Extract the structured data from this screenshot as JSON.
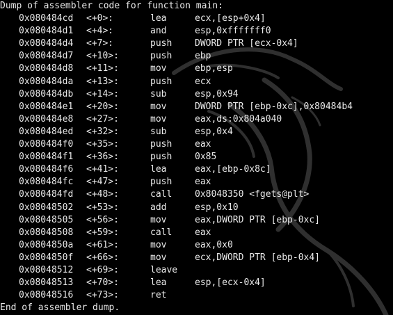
{
  "terminal": {
    "background": "#000000",
    "text_color": "#e9e9e9",
    "watermark": "kali-dragon-logo",
    "header": "Dump of assembler code for function main:",
    "footer": "End of assembler dump.",
    "rows": [
      {
        "addr": "0x080484cd",
        "off": "<+0>:",
        "mnem": "lea",
        "ops": "ecx,[esp+0x4]"
      },
      {
        "addr": "0x080484d1",
        "off": "<+4>:",
        "mnem": "and",
        "ops": "esp,0xfffffff0"
      },
      {
        "addr": "0x080484d4",
        "off": "<+7>:",
        "mnem": "push",
        "ops": "DWORD PTR [ecx-0x4]"
      },
      {
        "addr": "0x080484d7",
        "off": "<+10>:",
        "mnem": "push",
        "ops": "ebp"
      },
      {
        "addr": "0x080484d8",
        "off": "<+11>:",
        "mnem": "mov",
        "ops": "ebp,esp"
      },
      {
        "addr": "0x080484da",
        "off": "<+13>:",
        "mnem": "push",
        "ops": "ecx"
      },
      {
        "addr": "0x080484db",
        "off": "<+14>:",
        "mnem": "sub",
        "ops": "esp,0x94"
      },
      {
        "addr": "0x080484e1",
        "off": "<+20>:",
        "mnem": "mov",
        "ops": "DWORD PTR [ebp-0xc],0x80484b4"
      },
      {
        "addr": "0x080484e8",
        "off": "<+27>:",
        "mnem": "mov",
        "ops": "eax,ds:0x804a040"
      },
      {
        "addr": "0x080484ed",
        "off": "<+32>:",
        "mnem": "sub",
        "ops": "esp,0x4"
      },
      {
        "addr": "0x080484f0",
        "off": "<+35>:",
        "mnem": "push",
        "ops": "eax"
      },
      {
        "addr": "0x080484f1",
        "off": "<+36>:",
        "mnem": "push",
        "ops": "0x85"
      },
      {
        "addr": "0x080484f6",
        "off": "<+41>:",
        "mnem": "lea",
        "ops": "eax,[ebp-0x8c]"
      },
      {
        "addr": "0x080484fc",
        "off": "<+47>:",
        "mnem": "push",
        "ops": "eax"
      },
      {
        "addr": "0x080484fd",
        "off": "<+48>:",
        "mnem": "call",
        "ops": "0x8048350 <fgets@plt>"
      },
      {
        "addr": "0x08048502",
        "off": "<+53>:",
        "mnem": "add",
        "ops": "esp,0x10"
      },
      {
        "addr": "0x08048505",
        "off": "<+56>:",
        "mnem": "mov",
        "ops": "eax,DWORD PTR [ebp-0xc]"
      },
      {
        "addr": "0x08048508",
        "off": "<+59>:",
        "mnem": "call",
        "ops": "eax"
      },
      {
        "addr": "0x0804850a",
        "off": "<+61>:",
        "mnem": "mov",
        "ops": "eax,0x0"
      },
      {
        "addr": "0x0804850f",
        "off": "<+66>:",
        "mnem": "mov",
        "ops": "ecx,DWORD PTR [ebp-0x4]"
      },
      {
        "addr": "0x08048512",
        "off": "<+69>:",
        "mnem": "leave",
        "ops": ""
      },
      {
        "addr": "0x08048513",
        "off": "<+70>:",
        "mnem": "lea",
        "ops": "esp,[ecx-0x4]"
      },
      {
        "addr": "0x08048516",
        "off": "<+73>:",
        "mnem": "ret",
        "ops": ""
      }
    ]
  }
}
